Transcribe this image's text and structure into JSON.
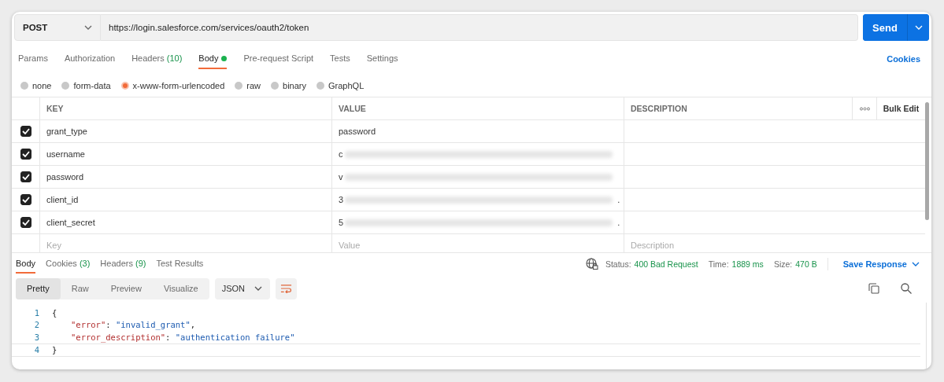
{
  "request": {
    "method": "POST",
    "url": "https://login.salesforce.com/services/oauth2/token",
    "send": "Send"
  },
  "request_tabs": [
    {
      "label": "Params",
      "dot": false,
      "selected": false
    },
    {
      "label": "Authorization",
      "dot": false,
      "selected": false
    },
    {
      "label": "Headers",
      "count": "(10)",
      "dot": false,
      "selected": false
    },
    {
      "label": "Body",
      "dot": true,
      "selected": true
    },
    {
      "label": "Pre-request Script",
      "dot": false,
      "selected": false
    },
    {
      "label": "Tests",
      "dot": false,
      "selected": false
    },
    {
      "label": "Settings",
      "dot": false,
      "selected": false
    }
  ],
  "cookies_link": "Cookies",
  "body_types": [
    {
      "label": "none",
      "selected": false
    },
    {
      "label": "form-data",
      "selected": false
    },
    {
      "label": "x-www-form-urlencoded",
      "selected": true
    },
    {
      "label": "raw",
      "selected": false
    },
    {
      "label": "binary",
      "selected": false
    },
    {
      "label": "GraphQL",
      "selected": false
    }
  ],
  "table": {
    "columns": [
      "KEY",
      "VALUE",
      "DESCRIPTION"
    ],
    "bulk_edit": "Bulk Edit",
    "rows": [
      {
        "checked": true,
        "key": "grant_type",
        "value": "password",
        "blurred": false,
        "suffix": ""
      },
      {
        "checked": true,
        "key": "username",
        "value": "c",
        "blurred": true,
        "suffix": ""
      },
      {
        "checked": true,
        "key": "password",
        "value": "v",
        "blurred": true,
        "suffix": ""
      },
      {
        "checked": true,
        "key": "client_id",
        "value": "3",
        "blurred": true,
        "suffix": "."
      },
      {
        "checked": true,
        "key": "client_secret",
        "value": "5",
        "blurred": true,
        "suffix": "."
      }
    ],
    "new_row": [
      {
        "placeholder": "Key"
      },
      {
        "placeholder": "Value"
      },
      {
        "placeholder": "Description"
      }
    ]
  },
  "response_tabs": [
    {
      "label": "Body",
      "selected": true
    },
    {
      "label": "Cookies",
      "count": "(3)",
      "selected": false
    },
    {
      "label": "Headers",
      "count": "(9)",
      "selected": false
    },
    {
      "label": "Test Results",
      "selected": false
    }
  ],
  "status": [
    {
      "label": "Status:",
      "value": "400 Bad Request"
    },
    {
      "label": "Time:",
      "value": "1889 ms"
    },
    {
      "label": "Size:",
      "value": "470 B"
    }
  ],
  "save_response": "Save Response",
  "view_modes": [
    {
      "label": "Pretty",
      "selected": true
    },
    {
      "label": "Raw",
      "selected": false
    },
    {
      "label": "Preview",
      "selected": false
    },
    {
      "label": "Visualize",
      "selected": false
    }
  ],
  "format": "JSON",
  "code_lines": [
    {
      "number": "1",
      "parts": [
        {
          "kind": "punct",
          "text": "{"
        }
      ]
    },
    {
      "number": "2",
      "parts": [
        {
          "kind": "key",
          "text": "\"error\""
        },
        {
          "kind": "punct",
          "text": ": "
        },
        {
          "kind": "string",
          "text": "\"invalid_grant\""
        },
        {
          "kind": "punct",
          "text": ","
        }
      ]
    },
    {
      "number": "3",
      "parts": [
        {
          "kind": "key",
          "text": "\"error_description\""
        },
        {
          "kind": "punct",
          "text": ": "
        },
        {
          "kind": "string",
          "text": "\"authentication failure\""
        }
      ]
    },
    {
      "number": "4",
      "parts": [
        {
          "kind": "punct",
          "text": "}"
        }
      ]
    }
  ]
}
